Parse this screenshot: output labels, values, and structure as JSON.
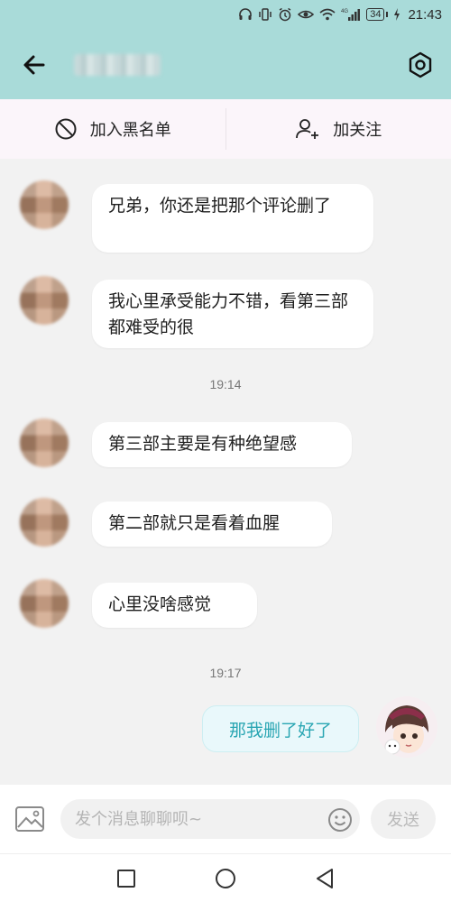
{
  "status_bar": {
    "time": "21:43",
    "battery": "34",
    "network": "4G",
    "icons": [
      "headphones-icon",
      "vibrate-icon",
      "alarm-icon",
      "eye-icon",
      "wifi-icon",
      "signal-icon",
      "battery-icon",
      "charging-icon"
    ]
  },
  "header": {
    "title": "",
    "back_icon": "back-arrow-icon",
    "settings_icon": "settings-hexagon-icon"
  },
  "actions": {
    "blacklist_label": "加入黑名单",
    "blacklist_icon": "block-icon",
    "follow_label": "加关注",
    "follow_icon": "add-user-icon"
  },
  "messages": [
    {
      "text": "兄弟，你还是把那个评论删了",
      "from": "other"
    },
    {
      "text": "我心里承受能力不错，看第三部都难受的很",
      "from": "other"
    },
    {
      "text": "第三部主要是有种绝望感",
      "from": "other"
    },
    {
      "text": "第二部就只是看着血腥",
      "from": "other"
    },
    {
      "text": "心里没啥感觉",
      "from": "other"
    },
    {
      "text": "那我删了好了",
      "from": "me"
    }
  ],
  "timestamps": [
    "19:14",
    "19:17"
  ],
  "input": {
    "placeholder": "发个消息聊聊呗~",
    "value": "",
    "send_label": "发送",
    "image_icon": "image-icon",
    "emoji_icon": "emoji-icon"
  },
  "nav": {
    "icons": [
      "recent-apps-icon",
      "home-icon",
      "back-triangle-icon"
    ]
  },
  "colors": {
    "header_bg": "#a9dbd9",
    "my_bubble_text": "#2aa6b3",
    "my_bubble_bg": "#e9f8fb"
  }
}
